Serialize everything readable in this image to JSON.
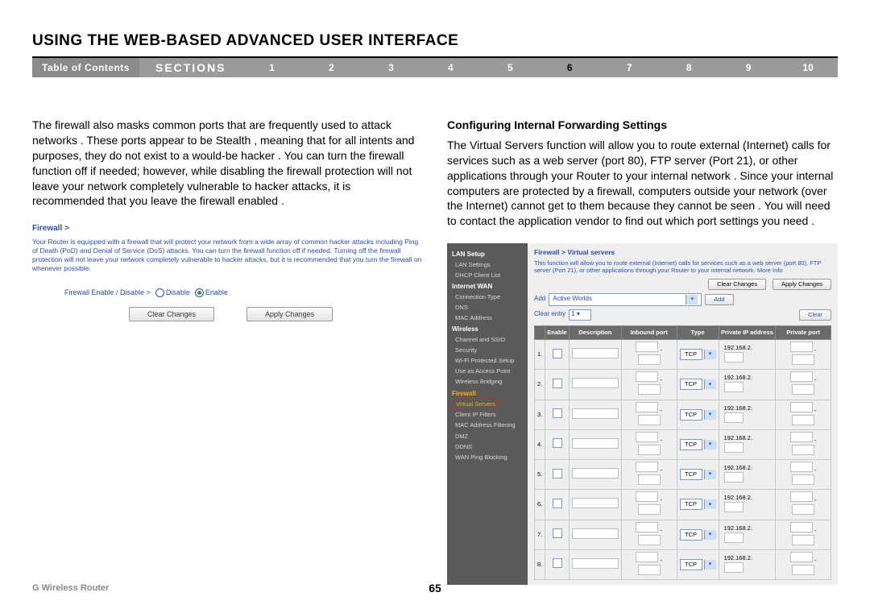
{
  "title": "USING THE WEB-BASED ADVANCED USER INTERFACE",
  "nav": {
    "toc": "Table of Contents",
    "sections_label": "SECTIONS",
    "numbers": [
      "1",
      "2",
      "3",
      "4",
      "5",
      "6",
      "7",
      "8",
      "9",
      "10"
    ],
    "active_index": 5
  },
  "left": {
    "body": "The firewall also masks common ports that are frequently used to attack networks . These ports appear to be  Stealth , meaning that for all intents and purposes, they do not exist to a would-be hacker  . You can turn the firewall function off if needed; however, while disabling the firewall protection will not leave your network completely vulnerable to hacker attacks, it is recommended that you leave the firewall enabled .",
    "fw_title": "Firewall >",
    "fw_desc": "Your Router is equipped with a firewall that will protect your network from a wide array of common hacker attacks including Ping of Death (PoD) and Denial of Service (DoS) attacks. You can turn the firewall function off if needed. Turning off the firewall protection will not leave your network completely vulnerable to hacker attacks, but it is recommended that you turn the firewall on whenever possible.",
    "fw_enable_label": "Firewall Enable / Disable >",
    "fw_opt_disable": "Disable",
    "fw_opt_enable": "Enable",
    "btn_clear": "Clear Changes",
    "btn_apply": "Apply Changes"
  },
  "right": {
    "heading": "Configuring Internal Forwarding Settings",
    "body": "The  Virtual Servers  function will allow you to route external (Internet) calls for services such as a web server (port 80), FTP server (Port 21), or other applications through your Router to your internal network . Since your internal computers are protected by a firewall, computers outside your network (over the Internet) cannot get to them because they cannot be  seen .  You will need to contact the application vendor to find out which port settings you need .",
    "side": {
      "groups": [
        {
          "title": "LAN Setup",
          "items": [
            "LAN Settings",
            "DHCP Client List"
          ]
        },
        {
          "title": "Internet WAN",
          "items": [
            "Connection Type",
            "DNS",
            "MAC Address"
          ]
        },
        {
          "title": "Wireless",
          "items": [
            "Channel and SSID",
            "Security",
            "Wi-Fi Protected Setup",
            "Use as Access Point",
            "Wireless Bridging"
          ]
        },
        {
          "title": "Firewall",
          "firewall": true,
          "items": [
            "Virtual Servers",
            "Client IP Filters",
            "MAC Address Filtering",
            "DMZ",
            "DDNS",
            "WAN Ping Blocking"
          ]
        }
      ]
    },
    "vs": {
      "breadcrumb": "Firewall > Virtual servers",
      "desc": "This function will allow you to route external (Internet) calls for services such as a web server (port 80), FTP server (Port 21), or other applications through your Router to your internal network.",
      "more": "More Info",
      "btn_clear": "Clear Changes",
      "btn_apply": "Apply Changes",
      "add_label": "Add",
      "add_value": "Active Worlds",
      "add_btn": "Add",
      "clear_label": "Clear entry",
      "clear_value": "1",
      "clear_btn": "Clear",
      "headers": [
        "",
        "Enable",
        "Description",
        "Inbound port",
        "Type",
        "Private IP address",
        "Private port"
      ],
      "protocol": "TCP",
      "ip_prefix": "192.168.2.",
      "row_nums": [
        "1.",
        "2.",
        "3.",
        "4.",
        "5.",
        "6.",
        "7.",
        "8."
      ]
    }
  },
  "footer": {
    "left": "G Wireless Router",
    "page": "65"
  }
}
